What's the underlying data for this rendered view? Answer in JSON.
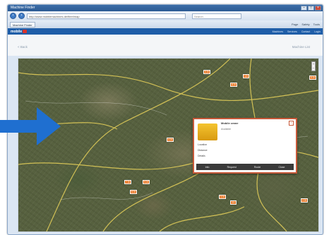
{
  "browser": {
    "title": "Machine Finder",
    "url": "http://www.mobilemachines.de/fleet/map",
    "search_placeholder": "Search",
    "tab_label": "Machine Finder",
    "toolbar_items": [
      "Page",
      "Safety",
      "Tools"
    ]
  },
  "app": {
    "logo": "mobile",
    "nav": [
      "Machines",
      "Services",
      "Contact",
      "Login"
    ]
  },
  "content": {
    "back_label": "< Back",
    "list_label": "Machine List"
  },
  "map": {
    "markers": [
      "3.5t",
      "8.0t",
      "12t",
      "5.5t",
      "4.0t",
      "7.5t",
      "9.0t",
      "6.0t",
      "3.0t",
      "11t",
      "2.5t"
    ]
  },
  "popup": {
    "title": "Mobile crane",
    "subtitle": "Available",
    "line1": "Location",
    "line2": "Distance",
    "line3": "Details",
    "buttons": [
      "Info",
      "Request",
      "Route",
      "Close"
    ]
  },
  "colors": {
    "arrow": "#1f6fd0",
    "marker": "#e8731e",
    "header": "#1f5ea8",
    "popup_border": "#c85a3a"
  }
}
